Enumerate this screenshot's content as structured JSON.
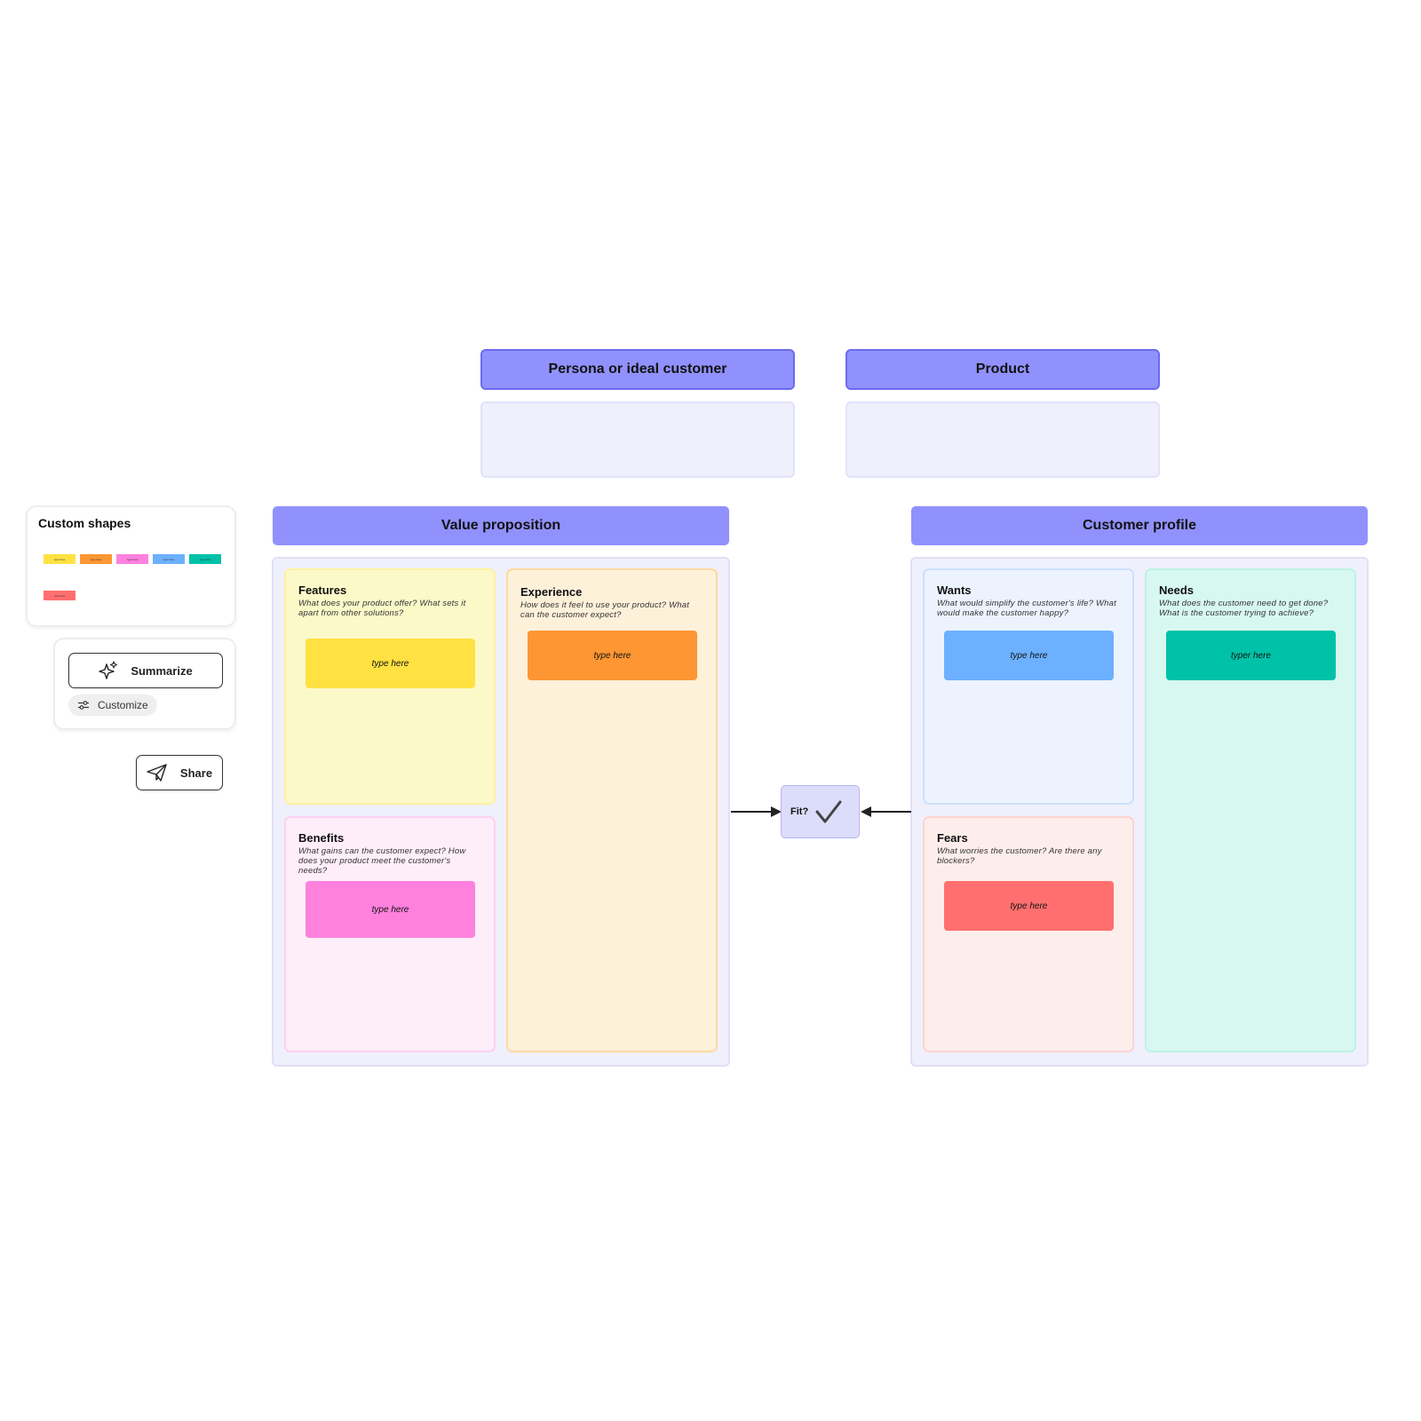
{
  "top": {
    "persona": {
      "title": "Persona or ideal customer"
    },
    "product": {
      "title": "Product"
    }
  },
  "value_proposition": {
    "title": "Value proposition",
    "features": {
      "title": "Features",
      "desc": "What does your product offer? What sets it apart from other solutions?",
      "sticky": "type here",
      "color": "#ffe142"
    },
    "experience": {
      "title": "Experience",
      "desc": "How does it feel to use your product? What can the customer expect?",
      "sticky": "type here",
      "color": "#fd9633"
    },
    "benefits": {
      "title": "Benefits",
      "desc": "What gains can the customer expect? How does your product meet the customer's needs?",
      "sticky": "type here",
      "color": "#ff81dd"
    }
  },
  "customer_profile": {
    "title": "Customer profile",
    "wants": {
      "title": "Wants",
      "desc": "What would simplify the customer's life? What would make the customer happy?",
      "sticky": "type here",
      "color": "#6cb0ff"
    },
    "needs": {
      "title": "Needs",
      "desc": "What does the customer need to get done? What is the customer trying to achieve?",
      "sticky": "typer here",
      "color": "#00c2a8"
    },
    "fears": {
      "title": "Fears",
      "desc": "What worries the customer? Are there any blockers?",
      "sticky": "type here",
      "color": "#ff6f6f"
    }
  },
  "fit": {
    "label": "Fit?",
    "icon": "checkmark-icon"
  },
  "custom_shapes": {
    "title": "Custom shapes",
    "swatches": [
      {
        "color": "#ffe142",
        "label": "type here"
      },
      {
        "color": "#fd9633",
        "label": "type here"
      },
      {
        "color": "#ff81dd",
        "label": "type here"
      },
      {
        "color": "#6cb0ff",
        "label": "type here"
      },
      {
        "color": "#00c2a8",
        "label": "type here"
      },
      {
        "color": "#ff6f6f",
        "label": "type here"
      }
    ]
  },
  "ai_panel": {
    "summarize_label": "Summarize",
    "customize_label": "Customize"
  },
  "share": {
    "label": "Share"
  }
}
